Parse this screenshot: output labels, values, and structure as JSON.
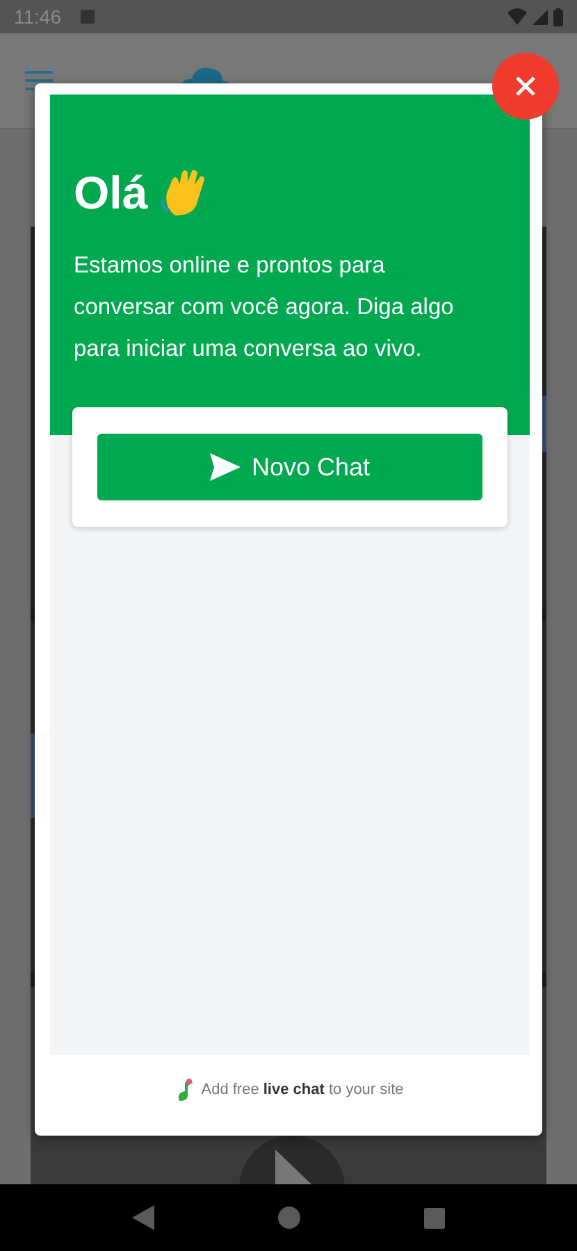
{
  "status_bar": {
    "time": "11:46"
  },
  "chat_widget": {
    "title": "Olá",
    "intro": "Estamos online e prontos para conversar com você agora. Diga algo para iniciar uma conversa ao vivo.",
    "new_chat_button": "Novo Chat",
    "footer": "Add free **live chat** to your site"
  }
}
